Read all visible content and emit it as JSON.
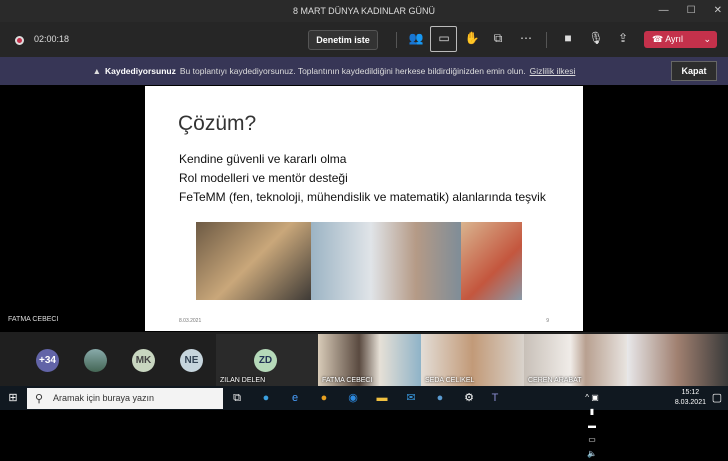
{
  "window": {
    "title": "8 MART DÜNYA KADINLAR GÜNÜ"
  },
  "toolbar": {
    "timer": "02:00:18",
    "control_label": "Denetim iste",
    "leave_label": "Ayrıl"
  },
  "banner": {
    "title": "Kaydediyorsunuz",
    "message": "Bu toplantıyı kaydediyorsunuz. Toplantının kaydedildiğini herkese bildirdiğinizden emin olun.",
    "link": "Gizlilik ilkesi",
    "close_label": "Kapat"
  },
  "slide": {
    "title": "Çözüm?",
    "bullets": [
      "Kendine güvenli ve kararlı olma",
      "Rol modelleri ve mentör desteği",
      "FeTeMM (fen, teknoloji, mühendislik ve matematik) alanlarında teşvik"
    ],
    "date": "8.03.2021",
    "page": "9"
  },
  "presenter": "FATMA CEBECI",
  "participants": {
    "overflow": "+34",
    "avatars": [
      "MK",
      "NE"
    ],
    "tiles": [
      {
        "initials": "ZD",
        "name": "ZILAN DELEN"
      },
      {
        "name": "FATMA CEBECI"
      },
      {
        "name": "SEDA CELIKEL"
      },
      {
        "name": "CEREN ARABAT"
      },
      {
        "name": ""
      }
    ]
  },
  "taskbar": {
    "search_placeholder": "Aramak için buraya yazın",
    "time": "15:12",
    "date": "8.03.2021"
  },
  "colors": {
    "leave": "#c4314b",
    "banner": "#373656",
    "accent": "#6264a7"
  }
}
